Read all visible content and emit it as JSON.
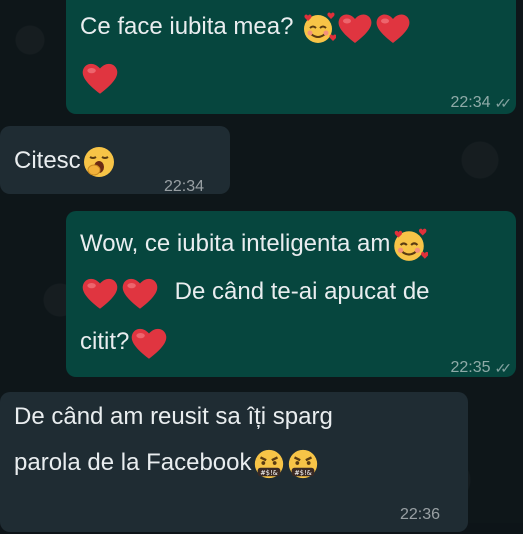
{
  "conversation": {
    "messages": [
      {
        "direction": "outgoing",
        "text": "Ce face iubita mea?",
        "emojis": [
          "smiling-face-with-hearts",
          "red-heart",
          "red-heart",
          "red-heart"
        ],
        "time": "22:34",
        "status": "read"
      },
      {
        "direction": "incoming",
        "text": "Citesc",
        "emojis": [
          "yawning-face"
        ],
        "time": "22:34"
      },
      {
        "direction": "outgoing",
        "text_line1": "Wow, ce iubita inteligenta am",
        "text_line2": "De când te-ai apucat de",
        "text_line3": "citit?",
        "emojis": [
          "smiling-face-with-hearts",
          "red-heart",
          "red-heart",
          "red-heart"
        ],
        "time": "22:35",
        "status": "read"
      },
      {
        "direction": "incoming",
        "text_line1": "De când am reusit sa îți sparg",
        "text_line2": "parola de la Facebook",
        "emojis": [
          "face-with-symbols-on-mouth",
          "face-with-symbols-on-mouth"
        ],
        "time": "22:36"
      }
    ]
  },
  "colors": {
    "outgoing_bubble": "#06463e",
    "incoming_bubble": "#1f2c33",
    "background": "#0e1619",
    "text": "#e9edef"
  }
}
